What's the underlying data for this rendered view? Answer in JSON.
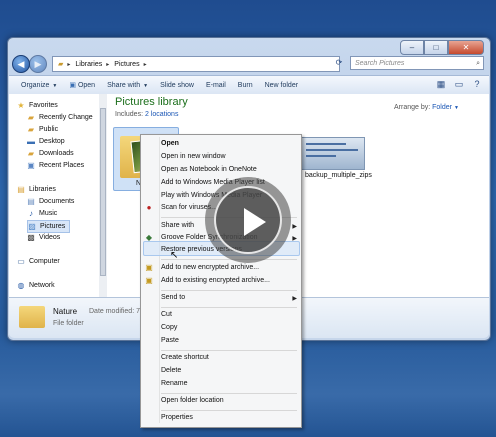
{
  "address": {
    "segments": [
      "Libraries",
      "Pictures"
    ]
  },
  "search": {
    "placeholder": "Search Pictures"
  },
  "toolbar": {
    "organize": "Organize",
    "open": "Open",
    "share_with": "Share with",
    "slide_show": "Slide show",
    "email": "E-mail",
    "burn": "Burn",
    "new_folder": "New folder"
  },
  "nav": {
    "favorites": "Favorites",
    "recently_changed": "Recently Change",
    "public": "Public",
    "desktop": "Desktop",
    "downloads": "Downloads",
    "recent_places": "Recent Places",
    "libraries": "Libraries",
    "documents": "Documents",
    "music": "Music",
    "pictures": "Pictures",
    "videos": "Videos",
    "computer": "Computer",
    "network": "Network"
  },
  "library": {
    "title": "Pictures library",
    "includes_label": "Includes:",
    "locations": "2 locations",
    "arrange_by_label": "Arrange by:",
    "arrange_by_value": "Folder"
  },
  "files": {
    "folder1_label": "Na",
    "zip_label": "backup_multiple_zips"
  },
  "details": {
    "name": "Nature",
    "modified_label": "Date modified: 7",
    "type": "File folder"
  },
  "menu": {
    "open": "Open",
    "open_new_window": "Open in new window",
    "open_onenote": "Open as Notebook in OneNote",
    "add_wmp": "Add to Windows Media Player list",
    "play_wmp": "Play with Windows Media Player",
    "scan": "Scan for viruses...",
    "share_with": "Share with",
    "groove": "Groove Folder Synchronization",
    "restore": "Restore previous versions",
    "add_encrypted": "Add to new encrypted archive...",
    "add_existing_encrypted": "Add to existing encrypted archive...",
    "send_to": "Send to",
    "cut": "Cut",
    "copy": "Copy",
    "paste": "Paste",
    "create_shortcut": "Create shortcut",
    "delete": "Delete",
    "rename": "Rename",
    "open_folder_location": "Open folder location",
    "properties": "Properties"
  }
}
